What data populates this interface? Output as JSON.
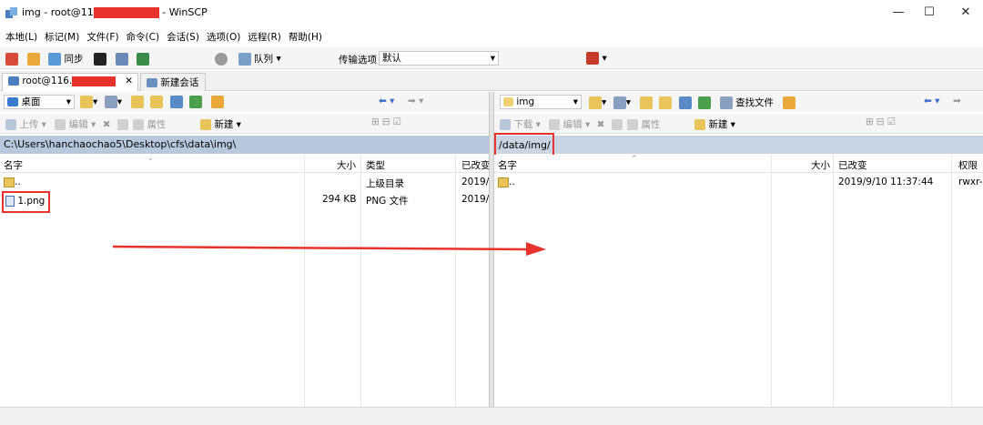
{
  "window": {
    "title_prefix": "img - root@11",
    "title_suffix": " - WinSCP",
    "minimize": "—",
    "maximize": "☐",
    "close": "✕"
  },
  "menu": [
    "本地(L)",
    "标记(M)",
    "文件(F)",
    "命令(C)",
    "会话(S)",
    "选项(O)",
    "远程(R)",
    "帮助(H)"
  ],
  "toolbar": {
    "sync_label": "同步",
    "queue_label": "队列",
    "transfer_options_label": "传输选项",
    "transfer_options_value": "默认"
  },
  "tabs": {
    "session_tab": "root@116.",
    "new_session": "新建会话"
  },
  "left_panel": {
    "location": "桌面",
    "upload": "上传",
    "edit": "编辑",
    "properties": "属性",
    "new": "新建",
    "path": "C:\\Users\\hanchaochao5\\Desktop\\cfs\\data\\img\\",
    "columns": {
      "name": "名字",
      "size": "大小",
      "type": "类型",
      "changed": "已改变"
    },
    "rows": [
      {
        "name": "..",
        "size": "",
        "type": "上级目录",
        "changed": "2019/"
      },
      {
        "name": "1.png",
        "size": "294 KB",
        "type": "PNG 文件",
        "changed": "2019/"
      }
    ]
  },
  "right_panel": {
    "location": "img",
    "find_files": "查找文件",
    "download": "下载",
    "edit": "编辑",
    "properties": "属性",
    "new": "新建",
    "path": "/data/img/",
    "columns": {
      "name": "名字",
      "size": "大小",
      "changed": "已改变",
      "rights": "权限"
    },
    "rows": [
      {
        "name": "..",
        "changed": "2019/9/10 11:37:44",
        "rights": "rwxr-"
      }
    ]
  },
  "colors": {
    "accent": "#e8322c",
    "path_bar": "#b8c8dc",
    "folder": "#e8c45a"
  }
}
